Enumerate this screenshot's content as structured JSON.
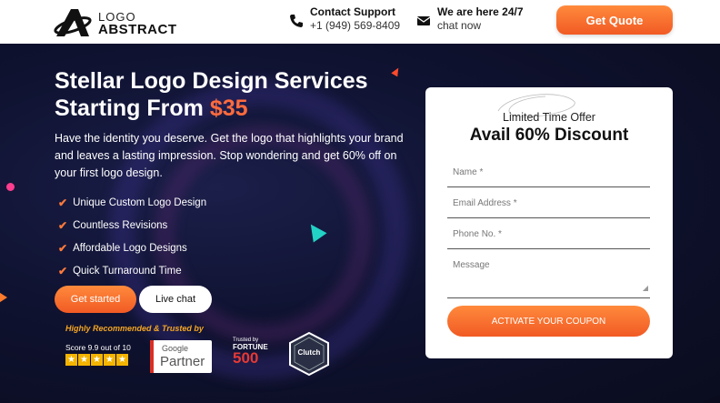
{
  "header": {
    "logo_line1": "LOGO",
    "logo_line2": "ABSTRACT",
    "contact_title": "Contact Support",
    "contact_phone": "+1 (949) 569-8409",
    "chat_title": "We are here 24/7",
    "chat_sub": "chat now",
    "quote_button": "Get Quote"
  },
  "hero": {
    "title_line1": "Stellar Logo Design Services",
    "title_line2_prefix": "Starting From ",
    "title_price": "$35",
    "description": "Have the identity you deserve. Get the logo that highlights your brand and leaves a lasting impression. Stop wondering and get 60% off on your first logo design.",
    "features": [
      "Unique Custom Logo Design",
      "Countless Revisions",
      "Affordable Logo Designs",
      "Quick Turnaround Time"
    ],
    "check_icon": "✔",
    "get_started": "Get started",
    "live_chat": "Live chat",
    "trusted_title": "Highly Recommended & Trusted by",
    "score_text": "Score 9.9 out of 10",
    "stars": [
      "★",
      "★",
      "★",
      "★",
      "★"
    ],
    "google_label": "Google",
    "partner_label": "Partner",
    "fortune_small": "Trusted by",
    "fortune_name": "FORTUNE",
    "fortune_number": "500",
    "clutch_label": "Clutch"
  },
  "form": {
    "kicker": "Limited Time Offer",
    "headline": "Avail 60% Discount",
    "name_placeholder": "Name *",
    "email_placeholder": "Email Address *",
    "phone_placeholder": "Phone No. *",
    "message_placeholder": "Message",
    "resize_grip": "◢",
    "submit": "ACTIVATE YOUR COUPON"
  },
  "colors": {
    "accent": "#f15a24",
    "hero_bg": "#0f1230",
    "star": "#f5b400"
  }
}
